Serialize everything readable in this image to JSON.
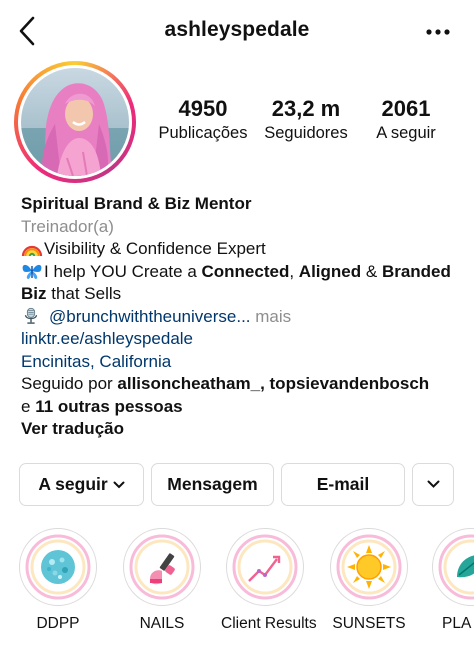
{
  "header": {
    "username": "ashleyspedale",
    "back_icon": "chevron-left-icon",
    "more_icon": "more-horizontal-icon"
  },
  "stats": [
    {
      "value": "4950",
      "label": "Publicações"
    },
    {
      "value": "23,2 m",
      "label": "Seguidores"
    },
    {
      "value": "2061",
      "label": "A seguir"
    }
  ],
  "bio": {
    "name": "Spiritual Brand & Biz Mentor",
    "category": "Treinador(a)",
    "line1": "Visibility & Confidence Expert",
    "line2_pre": "I help YOU Create a ",
    "line2_b1": "Connected",
    "line2_c1": ", ",
    "line2_b2": "Aligned",
    "line2_c2": " & ",
    "line2_b3": "Branded",
    "line3_b": "Biz",
    "line3_rest": " that Sells",
    "mention": "@brunchwiththeuniverse...",
    "more": "mais",
    "link": "linktr.ee/ashleyspedale",
    "location": "Encinitas, California",
    "followed_pre": "Seguido por ",
    "followed_b": "allisoncheatham_, topsievandenbosch",
    "followed_and": "e ",
    "followed_others": "11 outras pessoas",
    "translate": "Ver tradução"
  },
  "buttons": {
    "following": "A seguir",
    "message": "Mensagem",
    "email": "E-mail"
  },
  "highlights": [
    {
      "label": "DDPP",
      "icon": "glitter-ball-icon"
    },
    {
      "label": "NAILS",
      "icon": "nail-polish-icon"
    },
    {
      "label": "Client Results",
      "icon": "growth-chart-icon"
    },
    {
      "label": "SUNSETS",
      "icon": "sun-icon"
    },
    {
      "label": "PLA",
      "icon": "leaf-icon"
    }
  ],
  "colors": {
    "link": "#00376b",
    "muted": "#8e8e8e",
    "border": "#dbdbdb",
    "story_gradient": [
      "#f9ce34",
      "#ee2a7b",
      "#c13584"
    ]
  }
}
